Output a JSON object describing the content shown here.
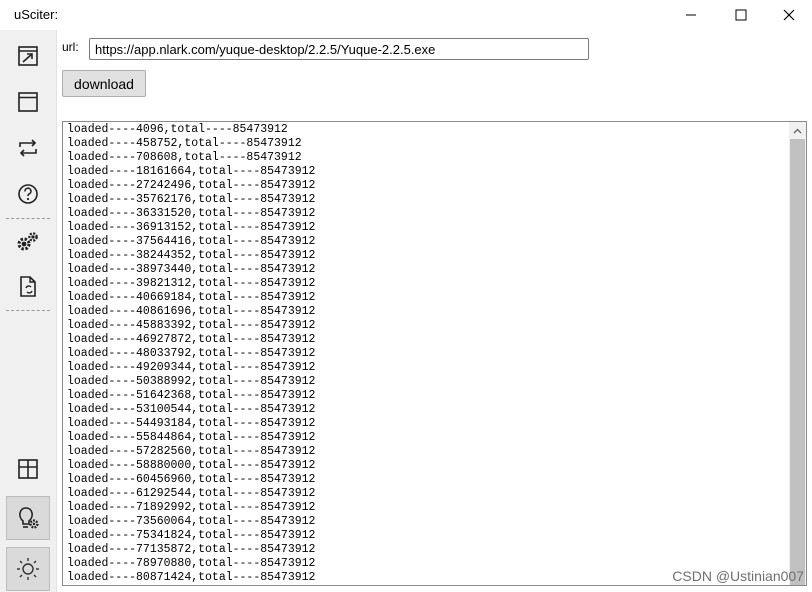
{
  "window": {
    "title": "uSciter:"
  },
  "sidebar": {
    "items": [
      {
        "icon": "external-window-icon"
      },
      {
        "icon": "browser-window-icon"
      },
      {
        "icon": "refresh-icon"
      },
      {
        "icon": "help-icon"
      },
      {
        "icon": "settings-gears-icon"
      },
      {
        "icon": "document-refresh-icon"
      },
      {
        "icon": "grid-layout-icon"
      },
      {
        "icon": "lightbulb-settings-icon"
      },
      {
        "icon": "sun-icon"
      }
    ]
  },
  "form": {
    "url_label": "url:",
    "url_value": "https://app.nlark.com/yuque-desktop/2.2.5/Yuque-2.2.5.exe",
    "download_label": "download"
  },
  "log": {
    "lines": [
      "loaded----4096,total----85473912",
      "loaded----458752,total----85473912",
      "loaded----708608,total----85473912",
      "loaded----18161664,total----85473912",
      "loaded----27242496,total----85473912",
      "loaded----35762176,total----85473912",
      "loaded----36331520,total----85473912",
      "loaded----36913152,total----85473912",
      "loaded----37564416,total----85473912",
      "loaded----38244352,total----85473912",
      "loaded----38973440,total----85473912",
      "loaded----39821312,total----85473912",
      "loaded----40669184,total----85473912",
      "loaded----40861696,total----85473912",
      "loaded----45883392,total----85473912",
      "loaded----46927872,total----85473912",
      "loaded----48033792,total----85473912",
      "loaded----49209344,total----85473912",
      "loaded----50388992,total----85473912",
      "loaded----51642368,total----85473912",
      "loaded----53100544,total----85473912",
      "loaded----54493184,total----85473912",
      "loaded----55844864,total----85473912",
      "loaded----57282560,total----85473912",
      "loaded----58880000,total----85473912",
      "loaded----60456960,total----85473912",
      "loaded----61292544,total----85473912",
      "loaded----71892992,total----85473912",
      "loaded----73560064,total----85473912",
      "loaded----75341824,total----85473912",
      "loaded----77135872,total----85473912",
      "loaded----78970880,total----85473912",
      "loaded----80871424,total----85473912"
    ]
  },
  "watermark": "CSDN @Ustinian007"
}
